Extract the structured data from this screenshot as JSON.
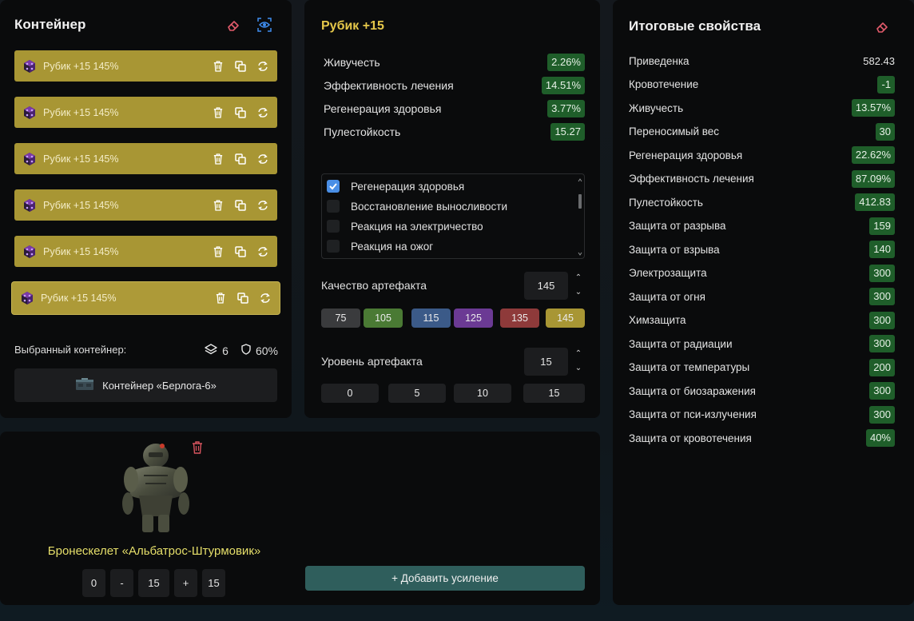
{
  "container_panel": {
    "title": "Контейнер",
    "slots": [
      {
        "label": "Рубик +15 145%"
      },
      {
        "label": "Рубик +15 145%"
      },
      {
        "label": "Рубик +15 145%"
      },
      {
        "label": "Рубик +15 145%"
      },
      {
        "label": "Рубик +15 145%"
      },
      {
        "label": "Рубик +15 145%"
      }
    ],
    "selected_label": "Выбранный контейнер:",
    "slot_count": "6",
    "protection": "60%",
    "container_name": "Контейнер «Берлога-6»"
  },
  "artifact_panel": {
    "title": "Рубик +15",
    "title_color": "#e6c84a",
    "stats": [
      {
        "name": "Живучесть",
        "value": "2.26%"
      },
      {
        "name": "Эффективность лечения",
        "value": "14.51%"
      },
      {
        "name": "Регенерация здоровья",
        "value": "3.77%"
      },
      {
        "name": "Пулестойкость",
        "value": "15.27"
      }
    ],
    "options": [
      {
        "label": "Регенерация здоровья",
        "checked": true
      },
      {
        "label": "Восстановление выносливости",
        "checked": false
      },
      {
        "label": "Реакция на электричество",
        "checked": false
      },
      {
        "label": "Реакция на ожог",
        "checked": false
      }
    ],
    "quality": {
      "label": "Качество артефакта",
      "value": "145",
      "presets": [
        {
          "label": "75",
          "color": "#3a3b3d"
        },
        {
          "label": "105",
          "color": "#4a7a34"
        },
        {
          "label": "115",
          "color": "#3b5a88"
        },
        {
          "label": "125",
          "color": "#6b3a94"
        },
        {
          "label": "135",
          "color": "#8e3a3a"
        },
        {
          "label": "145",
          "color": "#a89634"
        }
      ]
    },
    "level": {
      "label": "Уровень артефакта",
      "value": "15",
      "presets": [
        {
          "label": "0"
        },
        {
          "label": "5"
        },
        {
          "label": "10"
        },
        {
          "label": "15"
        }
      ]
    }
  },
  "totals_panel": {
    "title": "Итоговые свойства",
    "rows": [
      {
        "name": "Приведенка",
        "value": "582.43",
        "badge": false
      },
      {
        "name": "Кровотечение",
        "value": "-1",
        "badge": true
      },
      {
        "name": "Живучесть",
        "value": "13.57%",
        "badge": true
      },
      {
        "name": "Переносимый вес",
        "value": "30",
        "badge": true
      },
      {
        "name": "Регенерация здоровья",
        "value": "22.62%",
        "badge": true
      },
      {
        "name": "Эффективность лечения",
        "value": "87.09%",
        "badge": true
      },
      {
        "name": "Пулестойкость",
        "value": "412.83",
        "badge": true
      },
      {
        "name": "Защита от разрыва",
        "value": "159",
        "badge": true
      },
      {
        "name": "Защита от взрыва",
        "value": "140",
        "badge": true
      },
      {
        "name": "Электрозащита",
        "value": "300",
        "badge": true
      },
      {
        "name": "Защита от огня",
        "value": "300",
        "badge": true
      },
      {
        "name": "Химзащита",
        "value": "300",
        "badge": true
      },
      {
        "name": "Защита от радиации",
        "value": "300",
        "badge": true
      },
      {
        "name": "Защита от температуры",
        "value": "200",
        "badge": true
      },
      {
        "name": "Защита от биозаражения",
        "value": "300",
        "badge": true
      },
      {
        "name": "Защита от пси-излучения",
        "value": "300",
        "badge": true
      },
      {
        "name": "Защита от кровотечения",
        "value": "40%",
        "badge": true
      }
    ]
  },
  "armor_panel": {
    "name": "Бронескелет «Альбатрос-Штурмовик»",
    "min": "0",
    "minus": "-",
    "level": "15",
    "plus": "+",
    "max": "15",
    "add_button": "+ Добавить усиление"
  }
}
